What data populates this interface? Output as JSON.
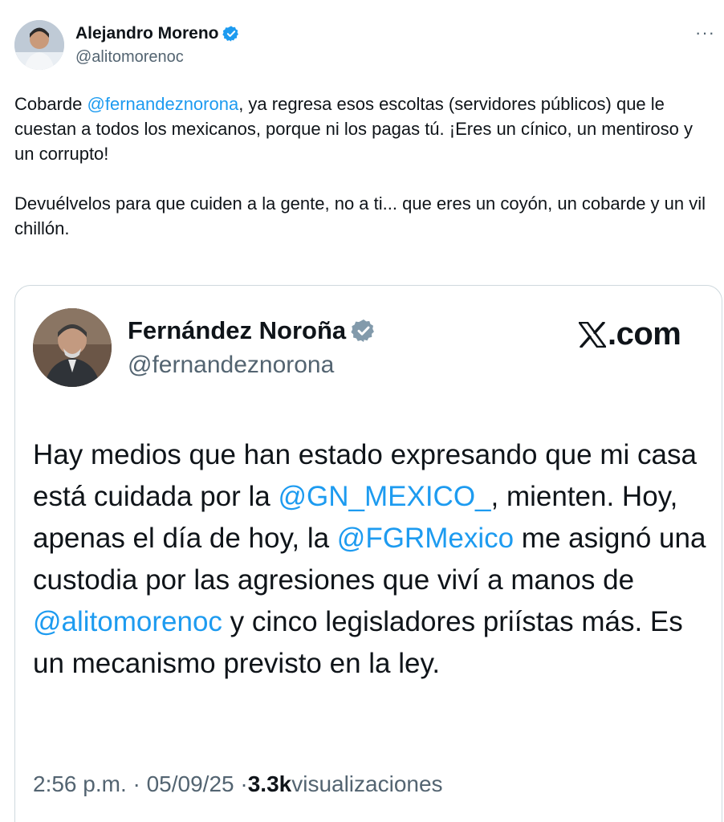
{
  "author": {
    "name": "Alejandro Moreno",
    "handle": "@alitomorenoc",
    "more_label": "···"
  },
  "post": {
    "p1_before": "Cobarde ",
    "p1_mention": "@fernandeznorona",
    "p1_after": ", ya regresa esos escoltas (servidores públicos) que le cuestan a todos los mexicanos, porque ni los pagas tú. ¡Eres un cínico, un mentiroso y un corrupto!",
    "p2": "Devuélvelos para que cuiden a la gente, no a ti... que eres un coyón, un cobarde y un vil chillón."
  },
  "quoted": {
    "name": "Fernández Noroña",
    "handle": "@fernandeznorona",
    "source_label": ".com",
    "text_1": "Hay medios que han estado expresando que mi casa está cuidada por la ",
    "mention_1": "@GN_MEXICO_",
    "text_2": ", mienten. Hoy, apenas el día de hoy, la ",
    "mention_2": "@FGRMexico",
    "text_3": " me asignó una custodia por las agresiones que viví a manos de ",
    "mention_3": "@alitomorenoc",
    "text_4": " y cinco legisladores priístas más. Es un mecanismo previsto en la ley.",
    "time": "2:56 p.m. · 05/09/25 · ",
    "views_count": "3.3k",
    "views_label": " visualizaciones"
  },
  "colors": {
    "link": "#1d9bf0",
    "secondary_text": "#536471",
    "verified_outer": "#1d9bf0",
    "verified_inner": "#829aab"
  },
  "icons": {
    "verified": "verified-badge-icon",
    "more": "more-horizontal-icon",
    "x_logo": "x-logo-icon"
  }
}
